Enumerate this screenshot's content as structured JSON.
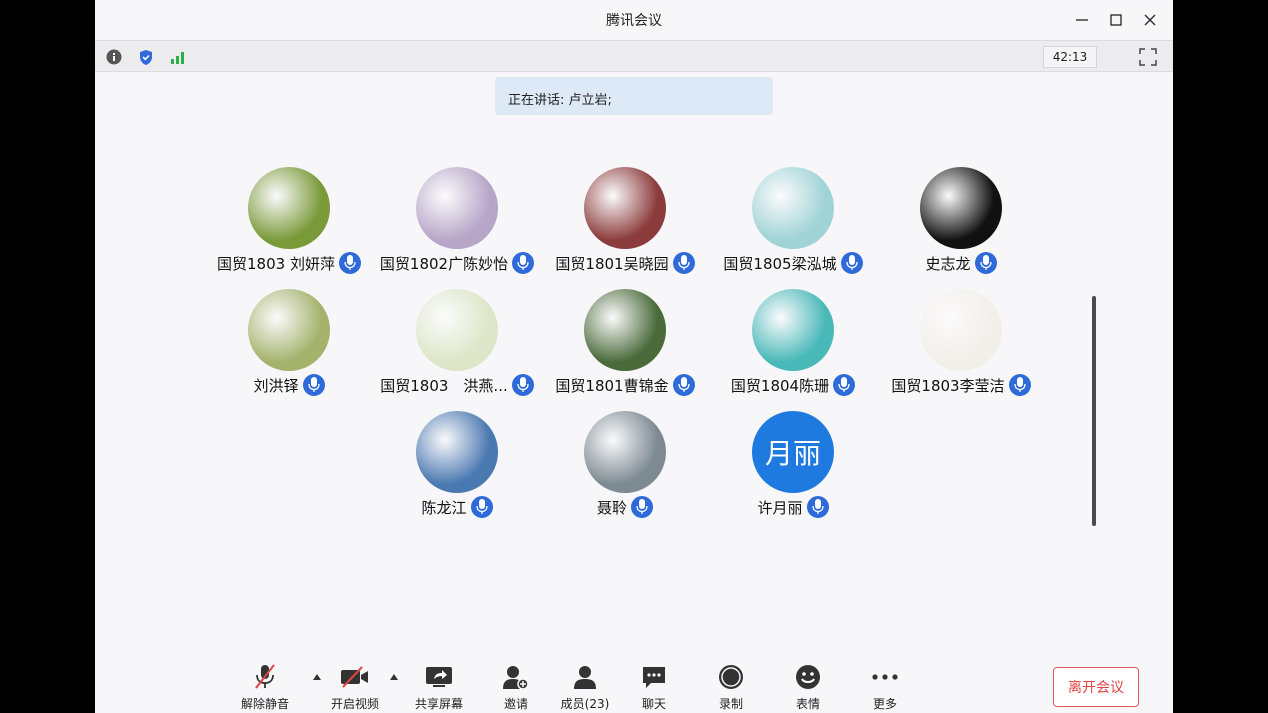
{
  "window": {
    "title": "腾讯会议"
  },
  "infobar": {
    "timer": "42:13"
  },
  "speaking": {
    "text": "正在讲话: 卢立岩;"
  },
  "participants": [
    {
      "name": "国贸1803 刘妍萍",
      "avatar": "photo",
      "color": "#7a9a3a"
    },
    {
      "name": "国贸1802广陈妙怡",
      "avatar": "photo",
      "color": "#b7a6c8"
    },
    {
      "name": "国贸1801吴晓园",
      "avatar": "photo",
      "color": "#8b3b3b"
    },
    {
      "name": "国贸1805梁泓城",
      "avatar": "photo",
      "color": "#9fd3d6"
    },
    {
      "name": "史志龙",
      "avatar": "photo",
      "color": "#111111"
    },
    {
      "name": "刘洪铎",
      "avatar": "photo",
      "color": "#a5b26c"
    },
    {
      "name": "国贸1803　洪燕...",
      "avatar": "photo",
      "color": "#dde6c8"
    },
    {
      "name": "国贸1801曹锦金",
      "avatar": "photo",
      "color": "#4a6a3a"
    },
    {
      "name": "国贸1804陈珊",
      "avatar": "photo",
      "color": "#49b8b8"
    },
    {
      "name": "国贸1803李莹洁",
      "avatar": "photo",
      "color": "#f2efe9"
    },
    {
      "name": "陈龙江",
      "avatar": "photo",
      "color": "#4a78b0"
    },
    {
      "name": "聂聆",
      "avatar": "photo",
      "color": "#7d8a92"
    },
    {
      "name": "许月丽",
      "avatar": "text",
      "avatar_text": "月丽",
      "color": "#1f7ae0"
    }
  ],
  "toolbar": {
    "unmute": "解除静音",
    "video": "开启视频",
    "share": "共享屏幕",
    "invite": "邀请",
    "members": "成员(23)",
    "chat": "聊天",
    "record": "录制",
    "emoji": "表情",
    "more": "更多",
    "leave": "离开会议"
  }
}
